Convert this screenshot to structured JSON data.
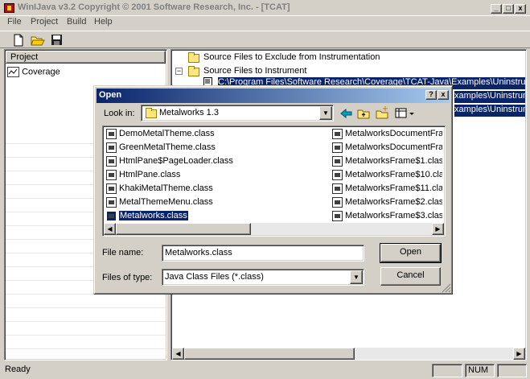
{
  "window": {
    "title": "WinIJava v3.2 Copyright © 2001 Software Research, Inc. - [TCAT]",
    "minimize_glyph": "_",
    "restore_glyph": "□",
    "close_glyph": "x"
  },
  "menu": [
    "File",
    "Project",
    "Build",
    "Help"
  ],
  "toolbar_icons": [
    "new-icon",
    "open-folder-icon",
    "save-icon"
  ],
  "left_pane": {
    "header": "Project",
    "items": [
      {
        "label": "Coverage",
        "icon": "coverage-icon"
      }
    ]
  },
  "tree": {
    "nodes": [
      {
        "label": "Source Files to Exclude from Instrumentation",
        "expander": ""
      },
      {
        "label": "Source Files to Instrument",
        "expander": "−"
      }
    ],
    "selected_rows": [
      "C:\\Program Files\\Software Research\\Coverage\\TCAT-Java\\Examples\\Uninstrum",
      "xamples\\Uninstrum",
      "xamples\\Uninstrum"
    ]
  },
  "dialog": {
    "title": "Open",
    "help_glyph": "?",
    "close_glyph": "x",
    "look_in_label": "Look in:",
    "look_in_value": "Metalworks 1.3",
    "file_name_label": "File name:",
    "file_name_value": "Metalworks.class",
    "file_type_label": "Files of type:",
    "file_type_value": "Java Class Files (*.class)",
    "open_button": "Open",
    "cancel_button": "Cancel",
    "files_col1": [
      "DemoMetalTheme.class",
      "GreenMetalTheme.class",
      "HtmlPane$PageLoader.class",
      "HtmlPane.class",
      "KhakiMetalTheme.class",
      "MetalThemeMenu.class",
      "Metalworks.class"
    ],
    "files_col2": [
      "MetalworksDocumentFram",
      "MetalworksDocumentFram",
      "MetalworksFrame$1.class",
      "MetalworksFrame$10.clas",
      "MetalworksFrame$11.clas",
      "MetalworksFrame$2.class",
      "MetalworksFrame$3.class"
    ],
    "selected_file": "Metalworks.class"
  },
  "status": {
    "text": "Ready",
    "num": "NUM"
  }
}
